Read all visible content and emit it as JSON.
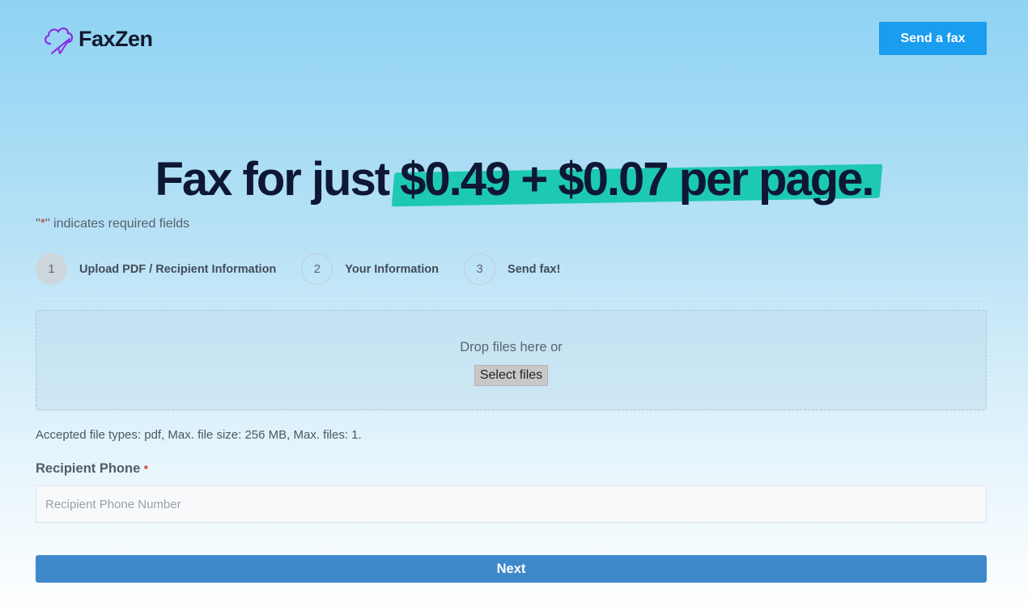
{
  "header": {
    "logo_text": "FaxZen",
    "logo_icon": "cloud-paper-plane-icon",
    "send_fax_label": "Send a fax"
  },
  "hero": {
    "prefix": "Fax for just ",
    "highlight": "$0.49 + $0.07 per page."
  },
  "required_note": {
    "quote_open": "\"",
    "star": "*",
    "text": "\" indicates required fields"
  },
  "steps": [
    {
      "number": "1",
      "label": "Upload PDF / Recipient Information",
      "active": true
    },
    {
      "number": "2",
      "label": "Your Information",
      "active": false
    },
    {
      "number": "3",
      "label": "Send fax!",
      "active": false
    }
  ],
  "dropzone": {
    "text": "Drop files here or",
    "select_label": "Select files"
  },
  "accepted_text": "Accepted file types: pdf, Max. file size: 256 MB, Max. files: 1.",
  "recipient": {
    "label": "Recipient Phone",
    "required_star": "*",
    "placeholder": "Recipient Phone Number"
  },
  "next_label": "Next",
  "colors": {
    "accent": "#1a9cef",
    "highlight": "#1ec9b4",
    "next_button": "#3f89cb",
    "logo": "#8a2be2"
  }
}
